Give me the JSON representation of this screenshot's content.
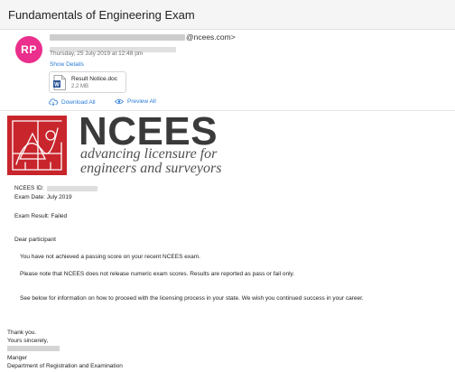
{
  "email": {
    "subject": "Fundamentals of Engineering Exam",
    "avatar_initials": "RP",
    "sender_domain": "@ncees.com>",
    "date": "Thursday, 25 July 2019 at 12:48 pm",
    "show_details": "Show Details"
  },
  "attachment": {
    "name": "Result Notice.doc",
    "size": "2.2 MB",
    "icon": "word-doc-icon"
  },
  "actions": {
    "download": "Download All",
    "preview": "Preview All"
  },
  "logo": {
    "word": "NCEES",
    "tagline_1": "advancing licensure for",
    "tagline_2": "engineers and surveyors",
    "color": "#c8252c"
  },
  "body": {
    "id_label": "NCEES ID:",
    "exam_date": "Exam Date: July 2019",
    "exam_result": "Exam Result: Failed",
    "greeting": "Dear participant",
    "para1": "You have not achieved a passing score on your recent NCEES exam.",
    "para2": "Please note that NCEES does not release numeric exam scores. Results are reported as pass or fail only.",
    "para3": "See below for information on how to proceed with the licensing process in your state. We wish you continued success in your career.",
    "thanks": "Thank you.",
    "sincerely": "Yours sincerely,",
    "title": "Manger",
    "department": "Department of Registration and Examination"
  },
  "colors": {
    "accent_link": "#2a7bd6",
    "avatar_bg": "#ea2f8c"
  }
}
